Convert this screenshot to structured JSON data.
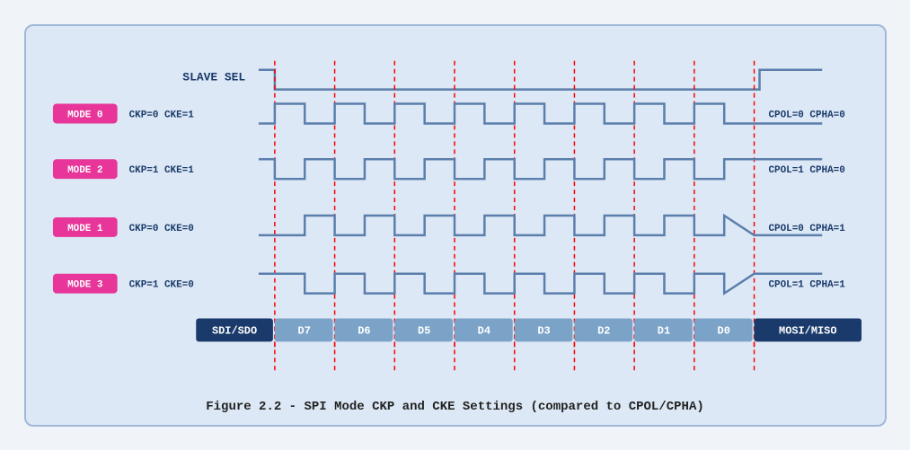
{
  "caption": "Figure 2.2 - SPI Mode CKP and CKE Settings (compared to CPOL/CPHA)",
  "diagram": {
    "slave_sel_label": "SLAVE SEL",
    "rows": [
      {
        "mode_label": "MODE 0",
        "ckp_cke": "CKP=0  CKE=1",
        "cpol_cpha": "CPOL=0  CPHA=0"
      },
      {
        "mode_label": "MODE 2",
        "ckp_cke": "CKP=1  CKE=1",
        "cpol_cpha": "CPOL=1  CPHA=0"
      },
      {
        "mode_label": "MODE 1",
        "ckp_cke": "CKP=0  CKE=0",
        "cpol_cpha": "CPOL=0  CPHA=1"
      },
      {
        "mode_label": "MODE 3",
        "ckp_cke": "CKP=1  CKE=0",
        "cpol_cpha": "CPOL=1  CPHA=1"
      }
    ],
    "data_bits": [
      "D7",
      "D6",
      "D5",
      "D4",
      "D3",
      "D2",
      "D1",
      "D0"
    ],
    "sdi_sdo": "SDI/SDO",
    "mosi_miso": "MOSI/MISO"
  }
}
